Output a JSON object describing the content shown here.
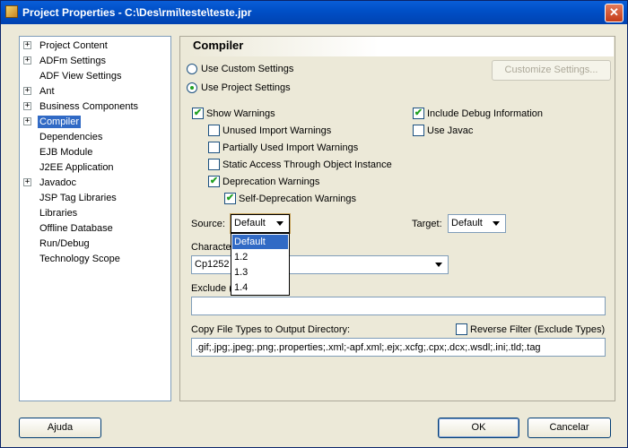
{
  "window": {
    "title": "Project Properties - C:\\Des\\rmi\\teste\\teste.jpr",
    "close_glyph": "✕"
  },
  "nav": {
    "items": [
      {
        "label": "Project Content",
        "expandable": true,
        "selected": false
      },
      {
        "label": "ADFm Settings",
        "expandable": true,
        "selected": false
      },
      {
        "label": "ADF View Settings",
        "expandable": false,
        "selected": false
      },
      {
        "label": "Ant",
        "expandable": true,
        "selected": false
      },
      {
        "label": "Business Components",
        "expandable": true,
        "selected": false
      },
      {
        "label": "Compiler",
        "expandable": true,
        "selected": true
      },
      {
        "label": "Dependencies",
        "expandable": false,
        "selected": false
      },
      {
        "label": "EJB Module",
        "expandable": false,
        "selected": false
      },
      {
        "label": "J2EE Application",
        "expandable": false,
        "selected": false
      },
      {
        "label": "Javadoc",
        "expandable": true,
        "selected": false
      },
      {
        "label": "JSP Tag Libraries",
        "expandable": false,
        "selected": false
      },
      {
        "label": "Libraries",
        "expandable": false,
        "selected": false
      },
      {
        "label": "Offline Database",
        "expandable": false,
        "selected": false
      },
      {
        "label": "Run/Debug",
        "expandable": false,
        "selected": false
      },
      {
        "label": "Technology Scope",
        "expandable": false,
        "selected": false
      }
    ],
    "expander_glyph": "+"
  },
  "compiler": {
    "header": "Compiler",
    "use_custom_settings": {
      "label": "Use Custom Settings",
      "checked": false
    },
    "use_project_settings": {
      "label": "Use Project Settings",
      "checked": true
    },
    "customize_button": "Customize Settings...",
    "check_glyph": "✔",
    "options": {
      "show_warnings": {
        "label": "Show Warnings",
        "checked": true
      },
      "unused_import": {
        "label": "Unused Import Warnings",
        "checked": false
      },
      "partially_used_import": {
        "label": "Partially Used Import Warnings",
        "checked": false
      },
      "static_access": {
        "label": "Static Access Through Object Instance",
        "checked": false
      },
      "deprecation": {
        "label": "Deprecation Warnings",
        "checked": true
      },
      "self_deprecation": {
        "label": "Self-Deprecation Warnings",
        "checked": true
      },
      "include_debug": {
        "label": "Include Debug Information",
        "checked": true
      },
      "use_javac": {
        "label": "Use Javac",
        "checked": false
      }
    },
    "source": {
      "label": "Source:",
      "value": "Default",
      "options": [
        "Default",
        "1.2",
        "1.3",
        "1.4"
      ],
      "highlighted": "Default"
    },
    "target": {
      "label": "Target:",
      "value": "Default"
    },
    "character_encoding": {
      "label_visible": "Characte",
      "value": "Cp1252"
    },
    "exclude": {
      "label_visible": "Exclude (",
      "value": ""
    },
    "copy_file_types": {
      "label": "Copy File Types to Output Directory:",
      "value": ".gif;.jpg;.jpeg;.png;.properties;.xml;-apf.xml;.ejx;.xcfg;.cpx;.dcx;.wsdl;.ini;.tld;.tag"
    },
    "reverse_filter": {
      "label": "Reverse Filter (Exclude Types)",
      "checked": false
    }
  },
  "footer": {
    "help_button": "Ajuda",
    "ok_button": "OK",
    "cancel_button": "Cancelar"
  },
  "colors": {
    "title_bar": "#0050c8",
    "selection": "#316ac5",
    "check": "#21a121",
    "dialog_bg": "#ece9d8"
  }
}
